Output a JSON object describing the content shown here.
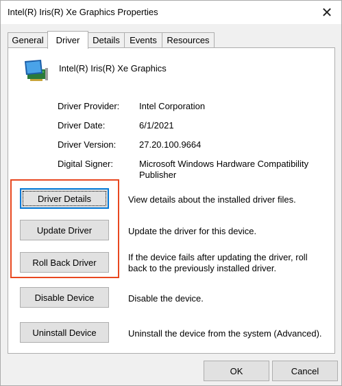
{
  "window": {
    "title": "Intel(R) Iris(R) Xe Graphics Properties"
  },
  "tabs": [
    {
      "label": "General",
      "active": false
    },
    {
      "label": "Driver",
      "active": true
    },
    {
      "label": "Details",
      "active": false
    },
    {
      "label": "Events",
      "active": false
    },
    {
      "label": "Resources",
      "active": false
    }
  ],
  "device": {
    "name": "Intel(R) Iris(R) Xe Graphics",
    "icon": "display-adapter-icon"
  },
  "info": {
    "provider_label": "Driver Provider:",
    "provider_value": "Intel Corporation",
    "date_label": "Driver Date:",
    "date_value": "6/1/2021",
    "version_label": "Driver Version:",
    "version_value": "27.20.100.9664",
    "signer_label": "Digital Signer:",
    "signer_value": "Microsoft Windows Hardware Compatibility Publisher"
  },
  "actions": {
    "details_label": "Driver Details",
    "details_desc": "View details about the installed driver files.",
    "update_label": "Update Driver",
    "update_desc": "Update the driver for this device.",
    "rollback_label": "Roll Back Driver",
    "rollback_desc": "If the device fails after updating the driver, roll back to the previously installed driver.",
    "disable_label": "Disable Device",
    "disable_desc": "Disable the device.",
    "uninstall_label": "Uninstall Device",
    "uninstall_desc": "Uninstall the device from the system (Advanced)."
  },
  "footer": {
    "ok_label": "OK",
    "cancel_label": "Cancel"
  },
  "colors": {
    "highlight": "#e8471f",
    "focus": "#0078d7"
  }
}
